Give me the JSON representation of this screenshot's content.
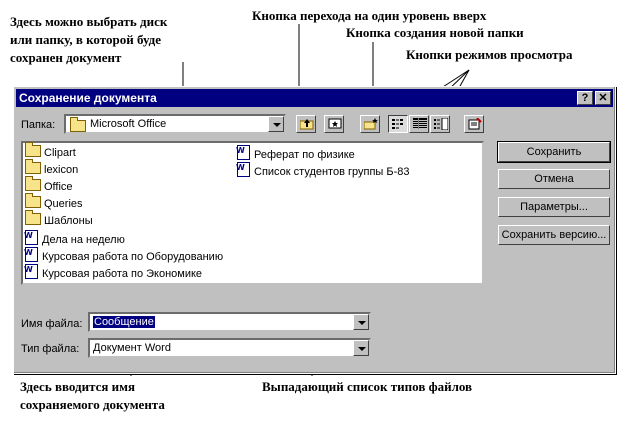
{
  "annotations": {
    "drive_folder": [
      "Здесь можно выбрать диск",
      "или папку, в которой буде",
      "сохранен документ"
    ],
    "up_one_level": "Кнопка перехода на один уровень вверх",
    "new_folder": "Кнопка создания новой папки",
    "view_modes": "Кнопки режимов просмотра",
    "filename_note": [
      "Здесь вводится имя",
      "сохраняемого документа"
    ],
    "filetype_note": "Выпадающий список типов файлов"
  },
  "dialog": {
    "title": "Сохранение документа",
    "help_glyph": "?",
    "close_glyph": "✕",
    "folder_label": "Папка:",
    "folder_value": "Microsoft Office",
    "files": [
      {
        "name": "Clipart",
        "kind": "folder"
      },
      {
        "name": "lexicon",
        "kind": "folder"
      },
      {
        "name": "Office",
        "kind": "folder"
      },
      {
        "name": "Queries",
        "kind": "folder"
      },
      {
        "name": "Шаблоны",
        "kind": "folder"
      },
      {
        "name": "Дела на неделю",
        "kind": "doc"
      },
      {
        "name": "Курсовая работа по Оборудованию",
        "kind": "doc"
      },
      {
        "name": "Курсовая работа по Экономике",
        "kind": "doc"
      },
      {
        "name": "Реферат по физике",
        "kind": "doc"
      },
      {
        "name": "Список студентов группы Б-83",
        "kind": "doc"
      }
    ],
    "buttons": {
      "save": "Сохранить",
      "cancel": "Отмена",
      "params": "Параметры...",
      "save_version": "Сохранить версию..."
    },
    "filename_label": "Имя файла:",
    "filename_value": "Сообщение",
    "filetype_label": "Тип файла:",
    "filetype_value": "Документ Word"
  },
  "icons": {
    "up_one_level": "folder-up-icon",
    "new_folder": "new-folder-icon",
    "view_list": "list-view-icon",
    "view_details": "details-view-icon",
    "view_properties": "properties-view-icon",
    "tools": "tools-icon"
  },
  "colors": {
    "titlebar": "#000080",
    "dialog_face": "#c0c0c0",
    "selection": "#000080"
  }
}
